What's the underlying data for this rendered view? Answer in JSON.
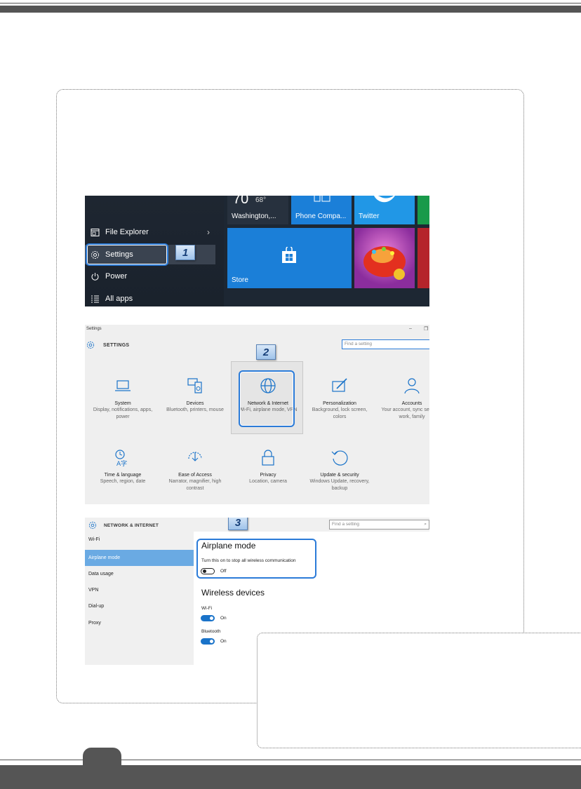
{
  "start_menu": {
    "items": [
      {
        "label": "File Explorer"
      },
      {
        "label": "Settings"
      },
      {
        "label": "Power"
      },
      {
        "label": "All apps"
      }
    ],
    "tiles": {
      "weather_temp": "70",
      "weather_low": "68°",
      "weather": "Washington,...",
      "phone": "Phone Compa...",
      "twitter": "Twitter",
      "store": "Store"
    },
    "step_badge": "1"
  },
  "settings_window": {
    "window_title": "Settings",
    "title": "SETTINGS",
    "search_placeholder": "Find a setting",
    "step_badge": "2",
    "categories": [
      {
        "title": "System",
        "desc": "Display, notifications, apps, power",
        "icon": "laptop-icon"
      },
      {
        "title": "Devices",
        "desc": "Bluetooth, printers, mouse",
        "icon": "devices-icon"
      },
      {
        "title": "Network & Internet",
        "desc": "Wi-Fi, airplane mode, VPN",
        "icon": "globe-icon"
      },
      {
        "title": "Personalization",
        "desc": "Background, lock screen, colors",
        "icon": "paint-icon"
      },
      {
        "title": "Accounts",
        "desc": "Your account, sync settings, work, family",
        "icon": "person-icon"
      },
      {
        "title": "Time & language",
        "desc": "Speech, region, date",
        "icon": "time-language-icon"
      },
      {
        "title": "Ease of Access",
        "desc": "Narrator, magnifier, high contrast",
        "icon": "ease-access-icon"
      },
      {
        "title": "Privacy",
        "desc": "Location, camera",
        "icon": "lock-icon"
      },
      {
        "title": "Update & security",
        "desc": "Windows Update, recovery, backup",
        "icon": "update-icon"
      }
    ]
  },
  "network_window": {
    "title": "NETWORK & INTERNET",
    "search_placeholder": "Find a setting",
    "step_badge": "3",
    "nav": [
      "Wi-Fi",
      "Airplane mode",
      "Data usage",
      "VPN",
      "Dial-up",
      "Proxy"
    ],
    "active_nav": "Airplane mode",
    "airplane": {
      "heading": "Airplane mode",
      "desc": "Turn this on to stop all wireless communication",
      "state": "Off"
    },
    "wireless": {
      "heading": "Wireless devices",
      "wifi_label": "Wi-Fi",
      "wifi_state": "On",
      "bt_label": "Bluetooth",
      "bt_state": "On"
    }
  }
}
